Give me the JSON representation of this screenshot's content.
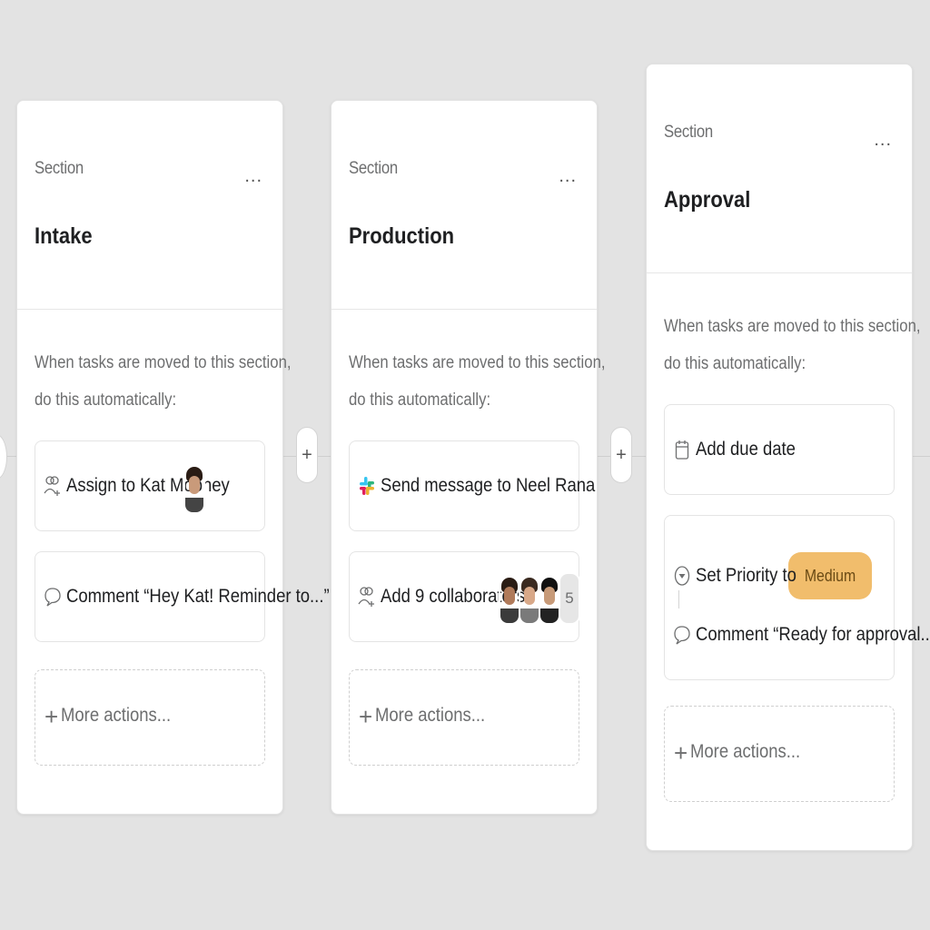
{
  "sections": [
    {
      "kicker": "Section",
      "title": "Intake",
      "description_line1": "When tasks are moved to this section,",
      "description_line2": "do this automatically:",
      "actions": [
        {
          "icon": "assign-user-icon",
          "label": "Assign to Kat Mooney"
        },
        {
          "icon": "comment-icon",
          "label": "Comment “Hey Kat! Reminder to...”"
        }
      ],
      "more_label": "More actions..."
    },
    {
      "kicker": "Section",
      "title": "Production",
      "description_line1": "When tasks are moved to this section,",
      "description_line2": "do this automatically:",
      "actions": [
        {
          "icon": "slack-icon",
          "label": "Send message to Neel Rana"
        },
        {
          "icon": "collaborators-icon",
          "label": "Add 9 collaborators",
          "overflow_count": "5"
        }
      ],
      "more_label": "More actions..."
    },
    {
      "kicker": "Section",
      "title": "Approval",
      "description_line1": "When tasks are moved to this section,",
      "description_line2": "do this automatically:",
      "actions": [
        {
          "icon": "calendar-icon",
          "label": "Add due date"
        },
        {
          "icon": "priority-dropdown-icon",
          "label": "Set Priority to",
          "badge": "Medium",
          "then_icon": "comment-icon",
          "then_label": "Comment “Ready for approval...”"
        }
      ],
      "more_label": "More actions..."
    }
  ],
  "add_button_glyph": "+",
  "menu_glyph": "...",
  "colors": {
    "background": "#e3e3e3",
    "card": "#ffffff",
    "badge_medium": "#f1bd6c",
    "slack_green": "#2eb67d",
    "slack_blue": "#36c5f0",
    "slack_yellow": "#ecb22e",
    "slack_red": "#e01e5a"
  }
}
